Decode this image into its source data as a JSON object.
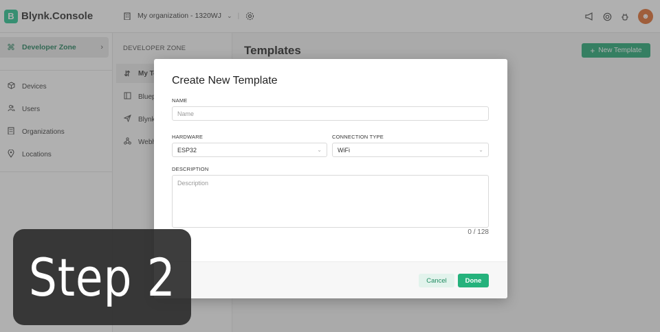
{
  "app": {
    "logo_letter": "B",
    "name": "Blynk.Console"
  },
  "header": {
    "org_name": "My organization - 1320WJ",
    "icons": [
      "building-icon",
      "chevron-down-icon",
      "settings-icon",
      "megaphone-icon",
      "help-icon",
      "bug-icon",
      "avatar"
    ]
  },
  "sidebar": {
    "zone_label": "Developer Zone",
    "items": [
      {
        "label": "Devices",
        "icon": "cube-icon"
      },
      {
        "label": "Users",
        "icon": "users-icon"
      },
      {
        "label": "Organizations",
        "icon": "building-icon"
      },
      {
        "label": "Locations",
        "icon": "pin-icon"
      }
    ]
  },
  "subnav": {
    "title": "DEVELOPER ZONE",
    "items": [
      {
        "label": "My Templates",
        "icon": "templates-icon"
      },
      {
        "label": "Blueprints",
        "icon": "book-icon"
      },
      {
        "label": "Blynk.Air",
        "icon": "send-icon"
      },
      {
        "label": "Webhooks",
        "icon": "webhook-icon"
      }
    ]
  },
  "main": {
    "title": "Templates",
    "new_button": "New Template"
  },
  "modal": {
    "title": "Create New Template",
    "name_label": "NAME",
    "name_placeholder": "Name",
    "hardware_label": "HARDWARE",
    "hardware_value": "ESP32",
    "connection_label": "CONNECTION TYPE",
    "connection_value": "WiFi",
    "description_label": "DESCRIPTION",
    "description_placeholder": "Description",
    "counter": "0 / 128",
    "cancel": "Cancel",
    "done": "Done"
  },
  "overlay_badge": {
    "text": "Step 2"
  },
  "colors": {
    "accent": "#23c48e",
    "button": "#1fa672",
    "badge_bg": "#2d2d2d"
  }
}
